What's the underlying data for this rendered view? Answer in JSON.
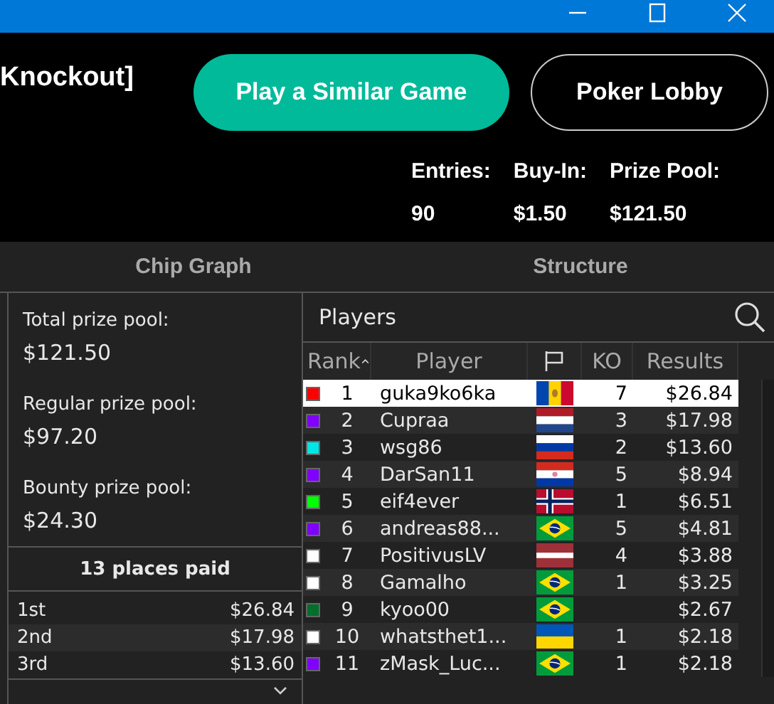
{
  "header": {
    "title": "Knockout]",
    "buttons": [
      {
        "label": "Play a Similar Game",
        "kind": "primary"
      },
      {
        "label": "Poker Lobby",
        "kind": "outline"
      }
    ],
    "stats": [
      {
        "label": "Entries:",
        "value": "90"
      },
      {
        "label": "Buy-In:",
        "value": "$1.50"
      },
      {
        "label": "Prize Pool:",
        "value": "$121.50"
      }
    ]
  },
  "tabs": [
    {
      "label": "Chip Graph",
      "selected": false
    },
    {
      "label": "Structure",
      "selected": false
    }
  ],
  "prize_panel": {
    "pools": [
      {
        "label": "Total prize pool:",
        "value": "$121.50"
      },
      {
        "label": "Regular prize pool:",
        "value": "$97.20"
      },
      {
        "label": "Bounty prize pool:",
        "value": "$24.30"
      }
    ],
    "places_paid": "13 places paid",
    "payouts": [
      {
        "place": "1st",
        "amount": "$26.84"
      },
      {
        "place": "2nd",
        "amount": "$17.98"
      },
      {
        "place": "3rd",
        "amount": "$13.60"
      }
    ]
  },
  "players": {
    "title": "Players",
    "columns": [
      "Rank",
      "Player",
      "KO",
      "Results"
    ],
    "rows": [
      {
        "color": "#ff0000",
        "rank": "1",
        "player": "guka9ko6ka",
        "flag": {
          "kind": "moldova"
        },
        "ko": "7",
        "result": "$26.84",
        "selected": true
      },
      {
        "color": "#8000ff",
        "rank": "2",
        "player": "Cupraa",
        "flag": {
          "kind": "netherlands"
        },
        "ko": "3",
        "result": "$17.98",
        "selected": false
      },
      {
        "color": "#00e5e5",
        "rank": "3",
        "player": "wsg86",
        "flag": {
          "kind": "russia"
        },
        "ko": "2",
        "result": "$13.60",
        "selected": false
      },
      {
        "color": "#8000ff",
        "rank": "4",
        "player": "DarSan11",
        "flag": {
          "kind": "paraguay"
        },
        "ko": "5",
        "result": "$8.94",
        "selected": false
      },
      {
        "color": "#00ff00",
        "rank": "5",
        "player": "eif4ever",
        "flag": {
          "kind": "norway"
        },
        "ko": "1",
        "result": "$6.51",
        "selected": false
      },
      {
        "color": "#8000ff",
        "rank": "6",
        "player": "andreas88...",
        "flag": {
          "kind": "brazil"
        },
        "ko": "5",
        "result": "$4.81",
        "selected": false
      },
      {
        "color": "#ffffff",
        "rank": "7",
        "player": "PositivusLV",
        "flag": {
          "kind": "latvia"
        },
        "ko": "4",
        "result": "$3.88",
        "selected": false
      },
      {
        "color": "#ffffff",
        "rank": "8",
        "player": "Gamalho",
        "flag": {
          "kind": "brazil"
        },
        "ko": "1",
        "result": "$3.25",
        "selected": false
      },
      {
        "color": "#00702a",
        "rank": "9",
        "player": "kyoo00",
        "flag": {
          "kind": "brazil"
        },
        "result": "$2.67",
        "selected": false
      },
      {
        "color": "#ffffff",
        "rank": "10",
        "player": "whatsthet1...",
        "flag": {
          "kind": "ukraine"
        },
        "ko": "1",
        "result": "$2.18",
        "selected": false
      },
      {
        "color": "#8000ff",
        "rank": "11",
        "player": "zMask_Luc...",
        "flag": {
          "kind": "brazil"
        },
        "ko": "1",
        "result": "$2.18",
        "selected": false
      }
    ]
  }
}
